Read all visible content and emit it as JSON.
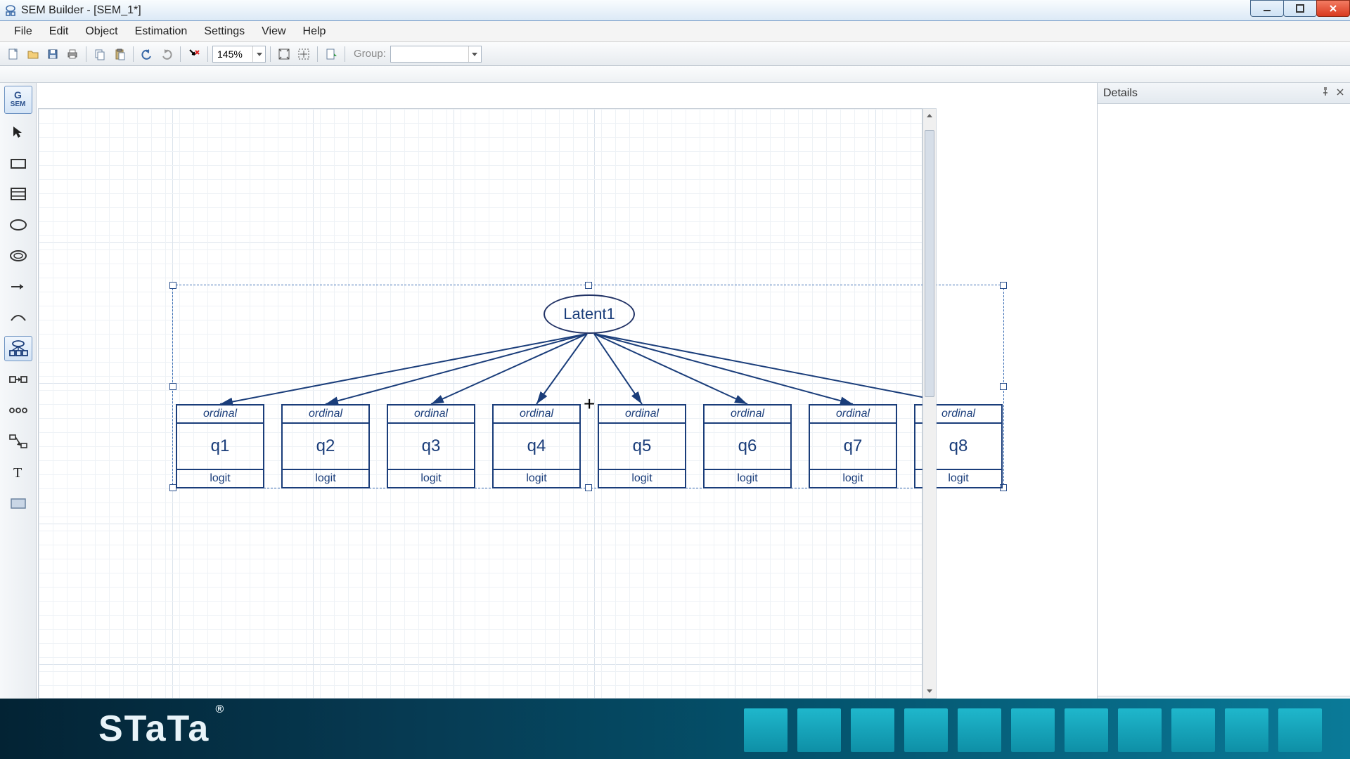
{
  "window": {
    "title": "SEM Builder - [SEM_1*]"
  },
  "menu": {
    "items": [
      "File",
      "Edit",
      "Object",
      "Estimation",
      "Settings",
      "View",
      "Help"
    ]
  },
  "toolbar": {
    "zoom": "145%",
    "group_label": "Group:",
    "group_value": ""
  },
  "palette": {
    "header_top": "G",
    "header_bottom": "SEM"
  },
  "details": {
    "title": "Details"
  },
  "diagram": {
    "latent": "Latent1",
    "measure_type": "ordinal",
    "link": "logit",
    "indicators": [
      "q1",
      "q2",
      "q3",
      "q4",
      "q5",
      "q6",
      "q7",
      "q8"
    ]
  },
  "footer": {
    "brand": "STaTa",
    "reg": "®"
  }
}
